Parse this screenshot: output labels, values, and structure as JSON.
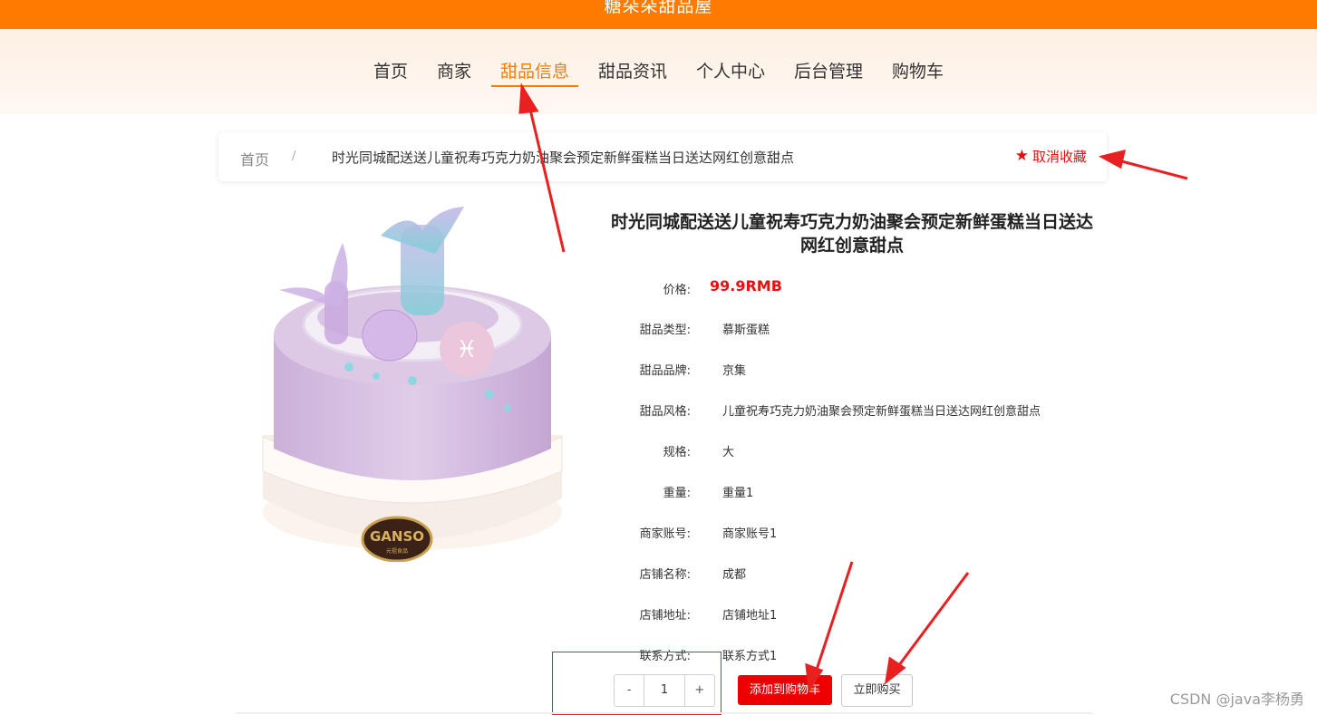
{
  "site": {
    "title": "糖朵朵甜品屋"
  },
  "nav": {
    "items": [
      {
        "label": "首页"
      },
      {
        "label": "商家"
      },
      {
        "label": "甜品信息"
      },
      {
        "label": "甜品资讯"
      },
      {
        "label": "个人中心"
      },
      {
        "label": "后台管理"
      },
      {
        "label": "购物车"
      }
    ],
    "active": "甜品信息"
  },
  "breadcrumb": {
    "home": "首页",
    "separator": "/",
    "current": "时光同城配送送儿童祝寿巧克力奶油聚会预定新鲜蛋糕当日送达网红创意甜点",
    "favorite_label": "取消收藏",
    "favorite_icon": "star-icon"
  },
  "product": {
    "title": "时光同城配送送儿童祝寿巧克力奶油聚会预定新鲜蛋糕当日送达网红创意甜点",
    "price_label": "价格:",
    "price": "99.9RMB",
    "fields": [
      {
        "label": "甜品类型:",
        "value": "慕斯蛋糕"
      },
      {
        "label": "甜品品牌:",
        "value": "京集"
      },
      {
        "label": "甜品风格:",
        "value": "儿童祝寿巧克力奶油聚会预定新鲜蛋糕当日送达网红创意甜点"
      },
      {
        "label": "规格:",
        "value": "大"
      },
      {
        "label": "重量:",
        "value": "重量1"
      },
      {
        "label": "商家账号:",
        "value": "商家账号1"
      },
      {
        "label": "店铺名称:",
        "value": "成都"
      },
      {
        "label": "店铺地址:",
        "value": "店铺地址1"
      },
      {
        "label": "联系方式:",
        "value": "联系方式1"
      }
    ],
    "image_logo_text": "GANSO",
    "image_logo_subtext": "元祖食品"
  },
  "purchase": {
    "minus": "-",
    "quantity": "1",
    "plus": "+",
    "add_to_cart": "添加到购物车",
    "buy_now": "立即购买"
  },
  "watermark": "CSDN @java李杨勇",
  "colors": {
    "brand": "#ff7a00",
    "price": "#e81010",
    "cart_button": "#ee0000",
    "annotation": "#e82020"
  }
}
